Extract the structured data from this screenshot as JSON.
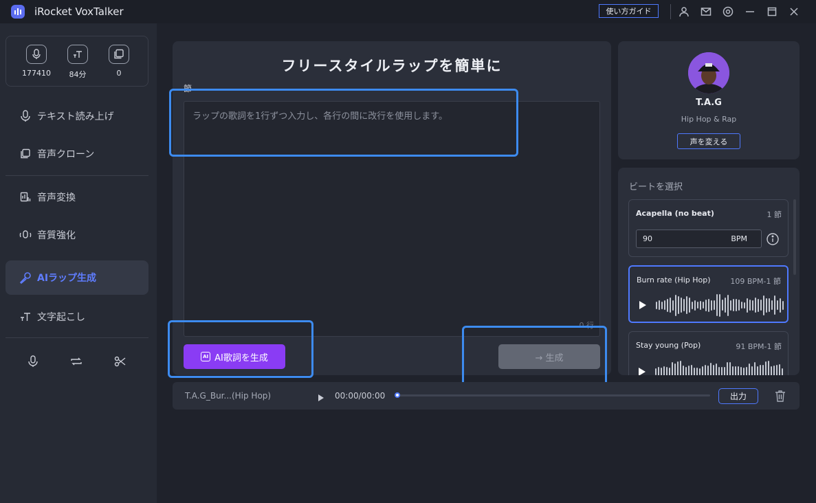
{
  "app": {
    "title": "iRocket VoxTalker",
    "guide_label": "使い方ガイド"
  },
  "titlebar_icons": [
    "user-icon",
    "mail-icon",
    "settings-icon",
    "minimize-icon",
    "maximize-icon",
    "close-icon"
  ],
  "stats": [
    {
      "icon": "microphone-icon",
      "value": "177410"
    },
    {
      "icon": "text-icon",
      "value": "84分"
    },
    {
      "icon": "clone-icon",
      "value": "0"
    }
  ],
  "nav": {
    "tts": "テキスト読み上げ",
    "clone": "音声クローン",
    "convert": "音声変換",
    "enhance": "音質強化",
    "rap": "AIラップ生成",
    "transcribe": "文字起こし"
  },
  "bottom_tools": [
    "record-icon",
    "loop-icon",
    "cut-icon"
  ],
  "main": {
    "title": "フリースタイルラップを簡単に",
    "verse_label": "節",
    "lyrics_placeholder": "ラップの歌詞を1行ずつ入力し、各行の間に改行を使用します。",
    "lyrics_value": "",
    "line_count": "0 行",
    "ai_button": "AI歌詞を生成",
    "ai_badge": "AI",
    "generate_button": "→ 生成"
  },
  "voice": {
    "name": "T.A.G",
    "genre": "Hip Hop & Rap",
    "change_label": "声を変える"
  },
  "beats": {
    "title": "ビートを選択",
    "items": [
      {
        "name": "Acapella (no beat)",
        "meta": "1 節",
        "bpm_value": "90",
        "bpm_unit": "BPM"
      },
      {
        "name": "Burn rate (Hip Hop)",
        "meta": "109 BPM-1 節",
        "selected": true
      },
      {
        "name": "Stay young (Pop)",
        "meta": "91 BPM-1 節"
      }
    ]
  },
  "player": {
    "track": "T.A.G_Bur...(Hip Hop)",
    "time": "00:00/00:00",
    "progress": 0,
    "export_label": "出力"
  },
  "colors": {
    "accent": "#4f79ff",
    "purple": "#8a3cf4",
    "highlight": "#3d8bef"
  }
}
